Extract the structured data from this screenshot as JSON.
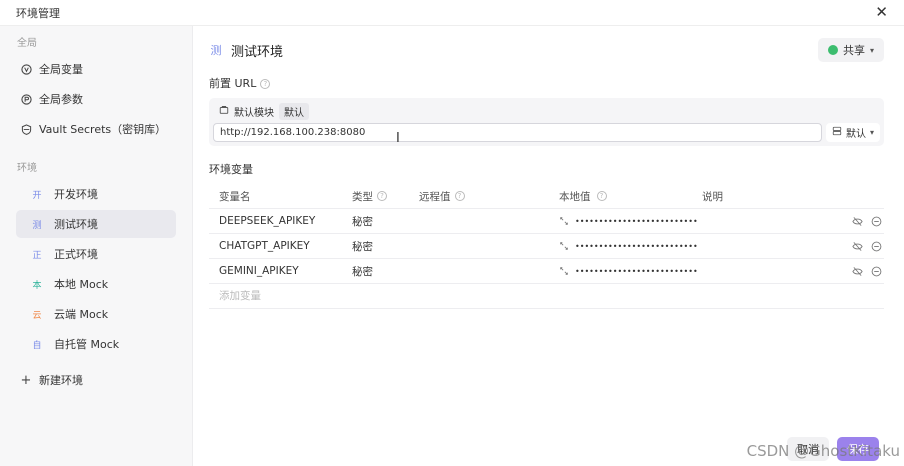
{
  "window": {
    "title": "环境管理"
  },
  "sidebar": {
    "global_label": "全局",
    "global_items": [
      {
        "label": "全局变量",
        "icon": "variable-icon"
      },
      {
        "label": "全局参数",
        "icon": "param-icon"
      },
      {
        "label": "Vault Secrets（密钥库）",
        "icon": "vault-icon"
      }
    ],
    "env_label": "环境",
    "envs": [
      {
        "badge": "开",
        "label": "开发环境",
        "color": "#7b8ce8"
      },
      {
        "badge": "测",
        "label": "测试环境",
        "color": "#7b8ce8"
      },
      {
        "badge": "正",
        "label": "正式环境",
        "color": "#7b8ce8"
      },
      {
        "badge": "本",
        "label": "本地 Mock",
        "color": "#2fb39b"
      },
      {
        "badge": "云",
        "label": "云端 Mock",
        "color": "#f08a4b"
      },
      {
        "badge": "自",
        "label": "自托管 Mock",
        "color": "#7b8ce8"
      }
    ],
    "new_env_label": "新建环境"
  },
  "main": {
    "env_badge": "测",
    "env_name": "测试环境",
    "share_label": "共享",
    "base_url_label": "前置 URL",
    "module_label": "默认模块",
    "module_tag": "默认",
    "url_value": "http://192.168.100.238:8080",
    "server_select": "默认",
    "vars_title": "环境变量",
    "columns": {
      "name": "变量名",
      "type": "类型",
      "remote": "远程值",
      "local": "本地值",
      "desc": "说明"
    },
    "rows": [
      {
        "name": "DEEPSEEK_APIKEY",
        "type": "秘密",
        "remote": "",
        "local": "••••••••••••••••••••••••••",
        "desc": ""
      },
      {
        "name": "CHATGPT_APIKEY",
        "type": "秘密",
        "remote": "",
        "local": "••••••••••••••••••••••••••",
        "desc": ""
      },
      {
        "name": "GEMINI_APIKEY",
        "type": "秘密",
        "remote": "",
        "local": "••••••••••••••••••••••••••",
        "desc": ""
      }
    ],
    "add_var_placeholder": "添加变量"
  },
  "footer": {
    "cancel_label": "取消",
    "ok_label": "保存"
  },
  "watermark": "CSDN @GhostKitaku"
}
